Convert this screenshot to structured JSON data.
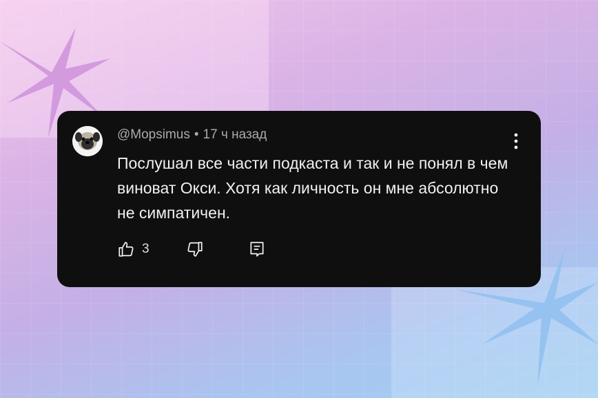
{
  "comment": {
    "username": "@Mopsimus",
    "separator": "•",
    "time_ago": "17 ч назад",
    "text": "Послушал все части подкаста и так и не понял в чем виноват Окси. Хотя как личность он мне абсолютно не симпатичен.",
    "avatar_icon": "pug-avatar",
    "menu_icon": "more-vertical-icon",
    "actions": {
      "like_icon": "thumbs-up-icon",
      "like_count": "3",
      "dislike_icon": "thumbs-down-icon",
      "reply_icon": "reply-comment-icon"
    }
  },
  "colors": {
    "card_background": "#0f0f0f",
    "text_primary": "#f1f1f1",
    "text_secondary": "#aaaaaa",
    "background_pink": "#f3c9ec",
    "background_blue": "#9fd0f2"
  }
}
